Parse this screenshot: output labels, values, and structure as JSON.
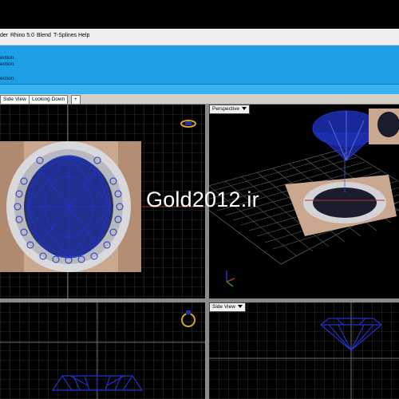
{
  "menubar": {
    "items": [
      "der",
      "Rhino 5.0",
      "Blend",
      "T-Splines",
      "Help"
    ]
  },
  "command_history": [
    "ection.",
    "ection.",
    "ection."
  ],
  "tabs": [
    "Side View",
    "Looking Down",
    "+"
  ],
  "viewports": {
    "perspective_label": "Perspective",
    "side_view_label": "Side View"
  },
  "watermark": "Gold2012.ir",
  "colors": {
    "command_area": "#1e9fe6",
    "wireframe": "#1f33c8",
    "grid": "#4a4a4a",
    "axis_red": "#b03030",
    "axis_green": "#2f8f2f"
  },
  "icons": [
    "ring-gold-icon",
    "ring-gold-small-icon",
    "axis-gizmo-icon"
  ]
}
